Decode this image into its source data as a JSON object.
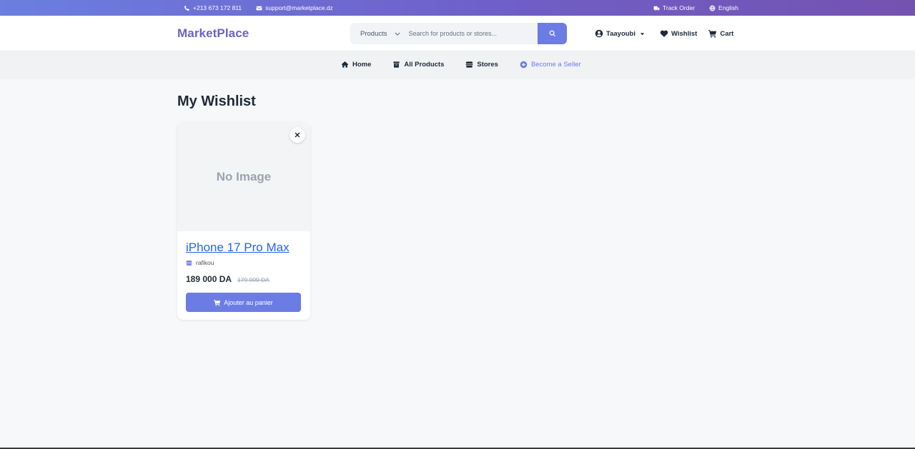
{
  "topbar": {
    "phone": "+213 673 172 811",
    "email": "support@marketplace.dz",
    "track_order": "Track Order",
    "language": "English"
  },
  "header": {
    "logo": "MarketPlace",
    "search": {
      "category": "Products",
      "placeholder": "Search for products or stores..."
    },
    "user": "Taayoubi",
    "wishlist": "Wishlist",
    "cart": "Cart"
  },
  "nav": {
    "home": "Home",
    "all_products": "All Products",
    "stores": "Stores",
    "become_seller": "Become a Seller"
  },
  "main": {
    "title": "My Wishlist",
    "items": [
      {
        "image_placeholder": "No Image",
        "name": "iPhone 17 Pro Max",
        "store": "rafikou",
        "price": "189 000 DA",
        "old_price": "179 000 DA",
        "button_label": "Ajouter au panier"
      }
    ]
  },
  "colors": {
    "brand": "#6a63c9",
    "accent": "#6b7ce5",
    "link": "#2563eb",
    "topbar_gradient_start": "#6b7fe0",
    "topbar_gradient_end": "#7452b0"
  },
  "icons": {
    "topbar": [
      "phone-icon",
      "envelope-icon",
      "truck-icon",
      "globe-icon"
    ],
    "header": [
      "chevron-down-icon",
      "search-icon",
      "user-circle-icon",
      "caret-down-icon",
      "heart-icon",
      "cart-icon"
    ],
    "nav": [
      "home-icon",
      "box-icon",
      "store-icon",
      "plus-circle-icon"
    ],
    "card": [
      "close-icon",
      "store-icon",
      "cart-icon"
    ]
  }
}
